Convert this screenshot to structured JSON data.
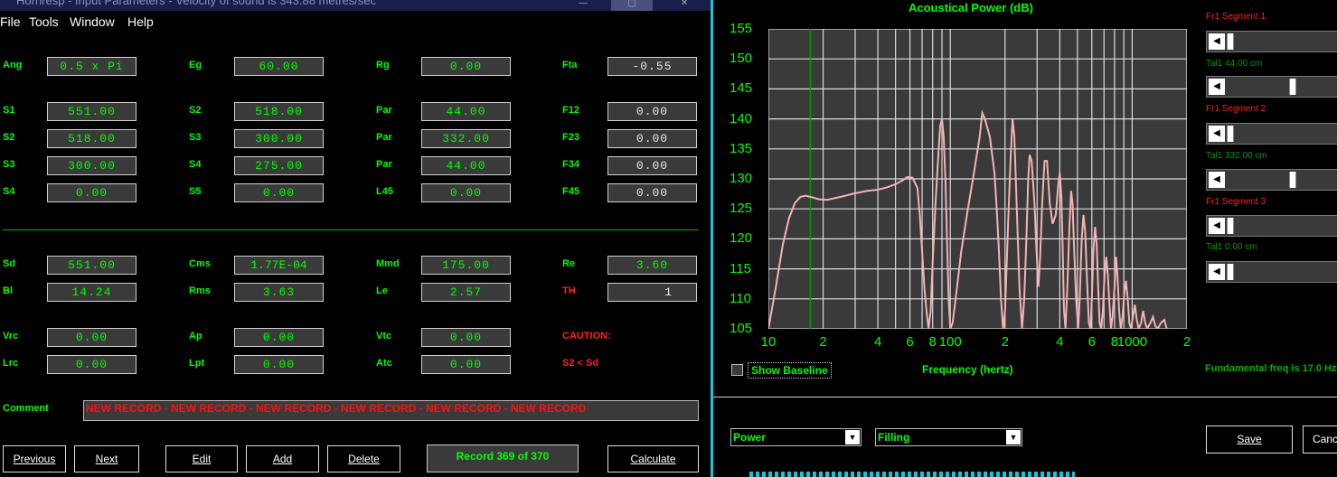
{
  "window": {
    "title": "Hornresp - Input Parameters - Velocity of sound is 343.88 metres/sec",
    "minimize": "—",
    "restore": "▢",
    "close": "✕"
  },
  "menu": {
    "file": "File",
    "tools": "Tools",
    "window": "Window",
    "help": "Help"
  },
  "params": [
    {
      "label": "Ang",
      "value": "0.5 x Pi"
    },
    {
      "label": "Eg",
      "value": "60.00"
    },
    {
      "label": "Rg",
      "value": "0.00"
    },
    {
      "label": "Fta",
      "value": "-0.55"
    },
    {
      "label": "S1",
      "value": "551.00"
    },
    {
      "label": "S2",
      "value": "518.00"
    },
    {
      "label": "Par",
      "value": "44.00"
    },
    {
      "label": "F12",
      "value": "0.00"
    },
    {
      "label": "S2",
      "value": "518.00"
    },
    {
      "label": "S3",
      "value": "300.00"
    },
    {
      "label": "Par",
      "value": "332.00"
    },
    {
      "label": "F23",
      "value": "0.00"
    },
    {
      "label": "S3",
      "value": "300.00"
    },
    {
      "label": "S4",
      "value": "275.00"
    },
    {
      "label": "Par",
      "value": "44.00"
    },
    {
      "label": "F34",
      "value": "0.00"
    },
    {
      "label": "S4",
      "value": "0.00"
    },
    {
      "label": "S5",
      "value": "0.00"
    },
    {
      "label": "L45",
      "value": "0.00"
    },
    {
      "label": "F45",
      "value": "0.00"
    },
    {
      "label": "Sd",
      "value": "551.00"
    },
    {
      "label": "Cms",
      "value": "1.77E-04"
    },
    {
      "label": "Mmd",
      "value": "175.00"
    },
    {
      "label": "Re",
      "value": "3.60"
    },
    {
      "label": "Bl",
      "value": "14.24"
    },
    {
      "label": "Rms",
      "value": "3.63"
    },
    {
      "label": "Le",
      "value": "2.57"
    },
    {
      "label": "TH",
      "value": "1"
    },
    {
      "label": "Vrc",
      "value": "0.00"
    },
    {
      "label": "Ap",
      "value": "0.00"
    },
    {
      "label": "Vtc",
      "value": "0.00"
    },
    {
      "label": "Lrc",
      "value": "0.00"
    },
    {
      "label": "Lpt",
      "value": "0.00"
    },
    {
      "label": "Atc",
      "value": "0.00"
    }
  ],
  "caution": {
    "title": "CAUTION:",
    "message": "S2 < Sd"
  },
  "comment": {
    "label": "Comment",
    "value": "NEW RECORD - NEW RECORD - NEW RECORD - NEW RECORD - NEW RECORD - NEW RECORD"
  },
  "buttons": {
    "previous": "Previous",
    "next": "Next",
    "edit": "Edit",
    "add": "Add",
    "delete": "Delete",
    "calculate": "Calculate"
  },
  "record": "Record 369 of 370",
  "chart_data": {
    "type": "line",
    "title": "Acoustical Power (dB)",
    "xlabel": "Frequency (hertz)",
    "ylabel": "",
    "x_scale": "log",
    "xlim": [
      10,
      2000
    ],
    "ylim": [
      105,
      155
    ],
    "yticks": [
      "155",
      "150",
      "145",
      "140",
      "135",
      "130",
      "125",
      "120",
      "115",
      "110",
      "105"
    ],
    "xticks": [
      {
        "label": "10",
        "value": 10
      },
      {
        "label": "2",
        "value": 20
      },
      {
        "label": "4",
        "value": 40
      },
      {
        "label": "6",
        "value": 60
      },
      {
        "label": "8",
        "value": 80
      },
      {
        "label": "100",
        "value": 100
      },
      {
        "label": "2",
        "value": 200
      },
      {
        "label": "4",
        "value": 400
      },
      {
        "label": "6",
        "value": 600
      },
      {
        "label": "8",
        "value": 800
      },
      {
        "label": "1000",
        "value": 1000
      },
      {
        "label": "2",
        "value": 2000
      }
    ],
    "grid": true,
    "marker_line_x": 17,
    "colors": {
      "curve": "#f4b2b4",
      "grid": "#dcdcdc",
      "background": "#3a3a3a",
      "marker": "#00a000"
    },
    "series": [
      {
        "points": [
          [
            10,
            105
          ],
          [
            11,
            112
          ],
          [
            12,
            119
          ],
          [
            13,
            123.5
          ],
          [
            14,
            126
          ],
          [
            15,
            127
          ],
          [
            16,
            127.2
          ],
          [
            17,
            127
          ],
          [
            19,
            126.6
          ],
          [
            21,
            126.5
          ],
          [
            25,
            127
          ],
          [
            30,
            127.6
          ],
          [
            35,
            128
          ],
          [
            40,
            128.2
          ],
          [
            45,
            128.6
          ],
          [
            50,
            129.1
          ],
          [
            55,
            129.8
          ],
          [
            58,
            130.3
          ],
          [
            62,
            130.2
          ],
          [
            66,
            128.5
          ],
          [
            68,
            124
          ],
          [
            70,
            118
          ],
          [
            72,
            112
          ],
          [
            74,
            108
          ],
          [
            76,
            105
          ],
          [
            78,
            108
          ],
          [
            80,
            116
          ],
          [
            83,
            126
          ],
          [
            86,
            134
          ],
          [
            88,
            138.7
          ],
          [
            90,
            140
          ],
          [
            92,
            137
          ],
          [
            94,
            130
          ],
          [
            96,
            120
          ],
          [
            98,
            110
          ],
          [
            100,
            105
          ],
          [
            103,
            106
          ],
          [
            108,
            111
          ],
          [
            115,
            118
          ],
          [
            125,
            125
          ],
          [
            135,
            131
          ],
          [
            145,
            137
          ],
          [
            150,
            141
          ],
          [
            155,
            140
          ],
          [
            165,
            137
          ],
          [
            175,
            131
          ],
          [
            180,
            125
          ],
          [
            185,
            118
          ],
          [
            190,
            110
          ],
          [
            195,
            105
          ],
          [
            200,
            108
          ],
          [
            205,
            117
          ],
          [
            210,
            126
          ],
          [
            215,
            134
          ],
          [
            220,
            140
          ],
          [
            225,
            137
          ],
          [
            232,
            125
          ],
          [
            240,
            112
          ],
          [
            248,
            105
          ],
          [
            255,
            110
          ],
          [
            262,
            120
          ],
          [
            268,
            130
          ],
          [
            273,
            134
          ],
          [
            280,
            133
          ],
          [
            290,
            126
          ],
          [
            298,
            118
          ],
          [
            305,
            112
          ],
          [
            312,
            117
          ],
          [
            320,
            126
          ],
          [
            330,
            133
          ],
          [
            340,
            133
          ],
          [
            352,
            126
          ],
          [
            365,
            122.5
          ],
          [
            380,
            124
          ],
          [
            392,
            129
          ],
          [
            400,
            131
          ],
          [
            408,
            127
          ],
          [
            415,
            118
          ],
          [
            422,
            108
          ],
          [
            430,
            105
          ],
          [
            440,
            112
          ],
          [
            452,
            122
          ],
          [
            462,
            128
          ],
          [
            470,
            126
          ],
          [
            480,
            118
          ],
          [
            492,
            110
          ],
          [
            505,
            105
          ],
          [
            515,
            110
          ],
          [
            528,
            120
          ],
          [
            540,
            124
          ],
          [
            552,
            121
          ],
          [
            565,
            113
          ],
          [
            578,
            106
          ],
          [
            590,
            105
          ],
          [
            600,
            110
          ],
          [
            612,
            118
          ],
          [
            625,
            122
          ],
          [
            638,
            119
          ],
          [
            650,
            112
          ],
          [
            662,
            106
          ],
          [
            675,
            105
          ],
          [
            690,
            108
          ],
          [
            705,
            114
          ],
          [
            720,
            117
          ],
          [
            735,
            114
          ],
          [
            750,
            109
          ],
          [
            765,
            105
          ],
          [
            780,
            107
          ],
          [
            800,
            112
          ],
          [
            815,
            117
          ],
          [
            830,
            114
          ],
          [
            848,
            108
          ],
          [
            865,
            105
          ],
          [
            885,
            107
          ],
          [
            905,
            111
          ],
          [
            925,
            113
          ],
          [
            945,
            110
          ],
          [
            965,
            106
          ],
          [
            985,
            105
          ],
          [
            1010,
            107
          ],
          [
            1035,
            109
          ],
          [
            1060,
            106.5
          ],
          [
            1085,
            105
          ],
          [
            1120,
            106
          ],
          [
            1150,
            108
          ],
          [
            1180,
            106
          ],
          [
            1210,
            105
          ],
          [
            1260,
            106
          ],
          [
            1300,
            107
          ],
          [
            1340,
            105.5
          ],
          [
            1380,
            105
          ],
          [
            1440,
            106
          ],
          [
            1500,
            106.5
          ],
          [
            1550,
            105
          ]
        ]
      }
    ]
  },
  "baseline": {
    "label": "Show Baseline"
  },
  "fundamental": "Fundamental freq is 17.0 Hz",
  "selects": {
    "power": "Power",
    "filling": "Filling"
  },
  "segments": [
    {
      "title": "Fr1  Segment 1",
      "tal": "Tal1  44.00 cm"
    },
    {
      "title": "Fr1  Segment 2",
      "tal": "Tal1  332.00 cm"
    },
    {
      "title": "Fr1  Segment 3",
      "tal": "Tal1  0.00 cm"
    }
  ],
  "slider_levels": [
    0,
    0.55,
    0,
    0.55,
    0,
    0
  ],
  "right_buttons": {
    "save": "Save",
    "cancel": "Cancel"
  }
}
